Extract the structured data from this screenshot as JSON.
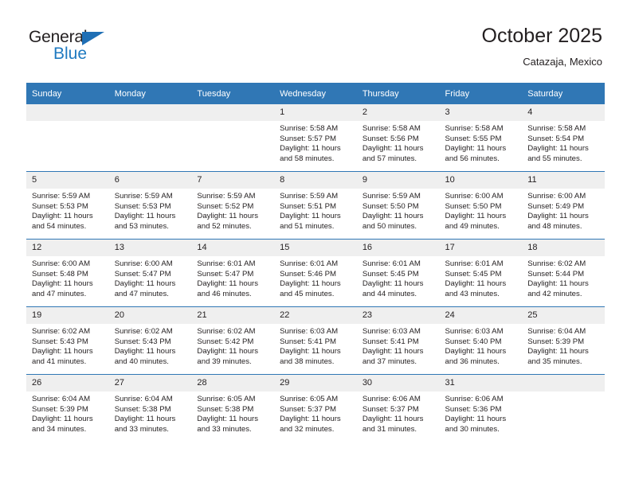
{
  "brand": {
    "name_top": "General",
    "name_bottom": "Blue",
    "triangle_color": "#1f6fb5",
    "blue_color": "#1f7ac0"
  },
  "header": {
    "title": "October 2025",
    "subtitle": "Catazaja, Mexico"
  },
  "colors": {
    "header_blue": "#3077b5",
    "daynum_band": "#efefef",
    "text": "#231f20"
  },
  "weekday_headers": [
    "Sunday",
    "Monday",
    "Tuesday",
    "Wednesday",
    "Thursday",
    "Friday",
    "Saturday"
  ],
  "labels": {
    "sunrise_prefix": "Sunrise:",
    "sunset_prefix": "Sunset:",
    "daylight_prefix": "Daylight:"
  },
  "weeks": [
    [
      {
        "day": "",
        "empty": true
      },
      {
        "day": "",
        "empty": true
      },
      {
        "day": "",
        "empty": true
      },
      {
        "day": "1",
        "sunrise": "Sunrise: 5:58 AM",
        "sunset": "Sunset: 5:57 PM",
        "daylight1": "Daylight: 11 hours",
        "daylight2": "and 58 minutes."
      },
      {
        "day": "2",
        "sunrise": "Sunrise: 5:58 AM",
        "sunset": "Sunset: 5:56 PM",
        "daylight1": "Daylight: 11 hours",
        "daylight2": "and 57 minutes."
      },
      {
        "day": "3",
        "sunrise": "Sunrise: 5:58 AM",
        "sunset": "Sunset: 5:55 PM",
        "daylight1": "Daylight: 11 hours",
        "daylight2": "and 56 minutes."
      },
      {
        "day": "4",
        "sunrise": "Sunrise: 5:58 AM",
        "sunset": "Sunset: 5:54 PM",
        "daylight1": "Daylight: 11 hours",
        "daylight2": "and 55 minutes."
      }
    ],
    [
      {
        "day": "5",
        "sunrise": "Sunrise: 5:59 AM",
        "sunset": "Sunset: 5:53 PM",
        "daylight1": "Daylight: 11 hours",
        "daylight2": "and 54 minutes."
      },
      {
        "day": "6",
        "sunrise": "Sunrise: 5:59 AM",
        "sunset": "Sunset: 5:53 PM",
        "daylight1": "Daylight: 11 hours",
        "daylight2": "and 53 minutes."
      },
      {
        "day": "7",
        "sunrise": "Sunrise: 5:59 AM",
        "sunset": "Sunset: 5:52 PM",
        "daylight1": "Daylight: 11 hours",
        "daylight2": "and 52 minutes."
      },
      {
        "day": "8",
        "sunrise": "Sunrise: 5:59 AM",
        "sunset": "Sunset: 5:51 PM",
        "daylight1": "Daylight: 11 hours",
        "daylight2": "and 51 minutes."
      },
      {
        "day": "9",
        "sunrise": "Sunrise: 5:59 AM",
        "sunset": "Sunset: 5:50 PM",
        "daylight1": "Daylight: 11 hours",
        "daylight2": "and 50 minutes."
      },
      {
        "day": "10",
        "sunrise": "Sunrise: 6:00 AM",
        "sunset": "Sunset: 5:50 PM",
        "daylight1": "Daylight: 11 hours",
        "daylight2": "and 49 minutes."
      },
      {
        "day": "11",
        "sunrise": "Sunrise: 6:00 AM",
        "sunset": "Sunset: 5:49 PM",
        "daylight1": "Daylight: 11 hours",
        "daylight2": "and 48 minutes."
      }
    ],
    [
      {
        "day": "12",
        "sunrise": "Sunrise: 6:00 AM",
        "sunset": "Sunset: 5:48 PM",
        "daylight1": "Daylight: 11 hours",
        "daylight2": "and 47 minutes."
      },
      {
        "day": "13",
        "sunrise": "Sunrise: 6:00 AM",
        "sunset": "Sunset: 5:47 PM",
        "daylight1": "Daylight: 11 hours",
        "daylight2": "and 47 minutes."
      },
      {
        "day": "14",
        "sunrise": "Sunrise: 6:01 AM",
        "sunset": "Sunset: 5:47 PM",
        "daylight1": "Daylight: 11 hours",
        "daylight2": "and 46 minutes."
      },
      {
        "day": "15",
        "sunrise": "Sunrise: 6:01 AM",
        "sunset": "Sunset: 5:46 PM",
        "daylight1": "Daylight: 11 hours",
        "daylight2": "and 45 minutes."
      },
      {
        "day": "16",
        "sunrise": "Sunrise: 6:01 AM",
        "sunset": "Sunset: 5:45 PM",
        "daylight1": "Daylight: 11 hours",
        "daylight2": "and 44 minutes."
      },
      {
        "day": "17",
        "sunrise": "Sunrise: 6:01 AM",
        "sunset": "Sunset: 5:45 PM",
        "daylight1": "Daylight: 11 hours",
        "daylight2": "and 43 minutes."
      },
      {
        "day": "18",
        "sunrise": "Sunrise: 6:02 AM",
        "sunset": "Sunset: 5:44 PM",
        "daylight1": "Daylight: 11 hours",
        "daylight2": "and 42 minutes."
      }
    ],
    [
      {
        "day": "19",
        "sunrise": "Sunrise: 6:02 AM",
        "sunset": "Sunset: 5:43 PM",
        "daylight1": "Daylight: 11 hours",
        "daylight2": "and 41 minutes."
      },
      {
        "day": "20",
        "sunrise": "Sunrise: 6:02 AM",
        "sunset": "Sunset: 5:43 PM",
        "daylight1": "Daylight: 11 hours",
        "daylight2": "and 40 minutes."
      },
      {
        "day": "21",
        "sunrise": "Sunrise: 6:02 AM",
        "sunset": "Sunset: 5:42 PM",
        "daylight1": "Daylight: 11 hours",
        "daylight2": "and 39 minutes."
      },
      {
        "day": "22",
        "sunrise": "Sunrise: 6:03 AM",
        "sunset": "Sunset: 5:41 PM",
        "daylight1": "Daylight: 11 hours",
        "daylight2": "and 38 minutes."
      },
      {
        "day": "23",
        "sunrise": "Sunrise: 6:03 AM",
        "sunset": "Sunset: 5:41 PM",
        "daylight1": "Daylight: 11 hours",
        "daylight2": "and 37 minutes."
      },
      {
        "day": "24",
        "sunrise": "Sunrise: 6:03 AM",
        "sunset": "Sunset: 5:40 PM",
        "daylight1": "Daylight: 11 hours",
        "daylight2": "and 36 minutes."
      },
      {
        "day": "25",
        "sunrise": "Sunrise: 6:04 AM",
        "sunset": "Sunset: 5:39 PM",
        "daylight1": "Daylight: 11 hours",
        "daylight2": "and 35 minutes."
      }
    ],
    [
      {
        "day": "26",
        "sunrise": "Sunrise: 6:04 AM",
        "sunset": "Sunset: 5:39 PM",
        "daylight1": "Daylight: 11 hours",
        "daylight2": "and 34 minutes."
      },
      {
        "day": "27",
        "sunrise": "Sunrise: 6:04 AM",
        "sunset": "Sunset: 5:38 PM",
        "daylight1": "Daylight: 11 hours",
        "daylight2": "and 33 minutes."
      },
      {
        "day": "28",
        "sunrise": "Sunrise: 6:05 AM",
        "sunset": "Sunset: 5:38 PM",
        "daylight1": "Daylight: 11 hours",
        "daylight2": "and 33 minutes."
      },
      {
        "day": "29",
        "sunrise": "Sunrise: 6:05 AM",
        "sunset": "Sunset: 5:37 PM",
        "daylight1": "Daylight: 11 hours",
        "daylight2": "and 32 minutes."
      },
      {
        "day": "30",
        "sunrise": "Sunrise: 6:06 AM",
        "sunset": "Sunset: 5:37 PM",
        "daylight1": "Daylight: 11 hours",
        "daylight2": "and 31 minutes."
      },
      {
        "day": "31",
        "sunrise": "Sunrise: 6:06 AM",
        "sunset": "Sunset: 5:36 PM",
        "daylight1": "Daylight: 11 hours",
        "daylight2": "and 30 minutes."
      },
      {
        "day": "",
        "empty": true
      }
    ]
  ]
}
